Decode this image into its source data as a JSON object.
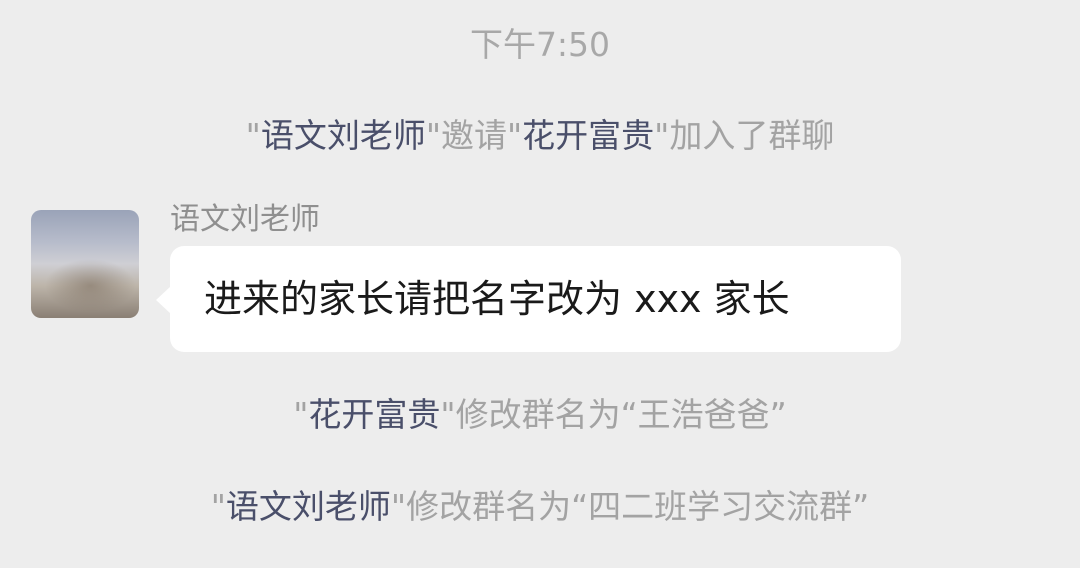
{
  "chat": {
    "timestamp": "下午7:50",
    "system1": {
      "q1": "\"",
      "inviter": "语文刘老师",
      "q2": "\"邀请\"",
      "invitee": "花开富贵",
      "q3": "\"加入了群聊"
    },
    "message": {
      "sender": "语文刘老师",
      "text": "进来的家长请把名字改为 xxx 家长",
      "avatar": "avatar-photo"
    },
    "system2": {
      "q1": "\"",
      "actor": "花开富贵",
      "rest": "\"修改群名为“王浩爸爸”"
    },
    "system3": {
      "q1": "\"",
      "actor": "语文刘老师",
      "rest": "\"修改群名为“四二班学习交流群”"
    }
  },
  "colors": {
    "background": "#ededed",
    "bubble": "#ffffff",
    "name_highlight": "#4a4f6a",
    "system_text": "#a3a3a3"
  }
}
